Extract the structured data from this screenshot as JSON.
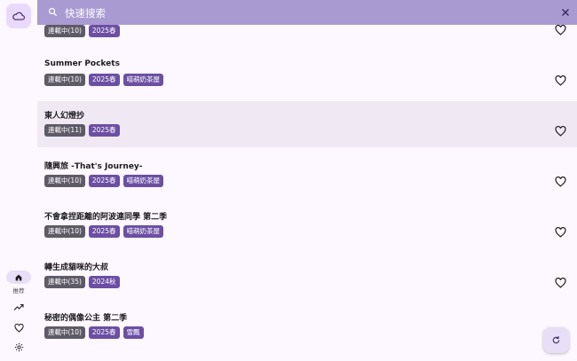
{
  "search": {
    "placeholder": "快速搜索"
  },
  "nav": {
    "home_label": "推荐",
    "items": [
      {
        "icon": "home-icon",
        "label": "推荐"
      },
      {
        "icon": "trending-icon"
      },
      {
        "icon": "heart-icon"
      },
      {
        "icon": "gear-icon"
      }
    ]
  },
  "list": [
    {
      "title": "",
      "tags": [
        "連載中(10)",
        "2025春"
      ],
      "favorite": false
    },
    {
      "title": "Summer Pockets",
      "tags": [
        "連載中(10)",
        "2025春",
        "喵萌奶茶屋"
      ],
      "favorite": false
    },
    {
      "title": "東人幻燈抄",
      "tags": [
        "連載中(11)",
        "2025春"
      ],
      "favorite": false,
      "selected": true
    },
    {
      "title": "隨興旅 -That's Journey-",
      "tags": [
        "連載中(10)",
        "2025春",
        "喵萌奶茶屋"
      ],
      "favorite": false
    },
    {
      "title": "不會拿捏距離的阿波連同學 第二季",
      "tags": [
        "連載中(10)",
        "2025春",
        "喵萌奶茶屋"
      ],
      "favorite": false
    },
    {
      "title": "轉生成貓咪的大叔",
      "tags": [
        "連載中(35)",
        "2024秋"
      ],
      "favorite": false
    },
    {
      "title": "秘密的偶像公主 第二季",
      "tags": [
        "連載中(10)",
        "2025春",
        "雪飄"
      ],
      "favorite": false
    }
  ],
  "colors": {
    "accent": "#a99bd1",
    "tag_status": "#5e5a66",
    "tag_season": "#6c4fa3"
  }
}
